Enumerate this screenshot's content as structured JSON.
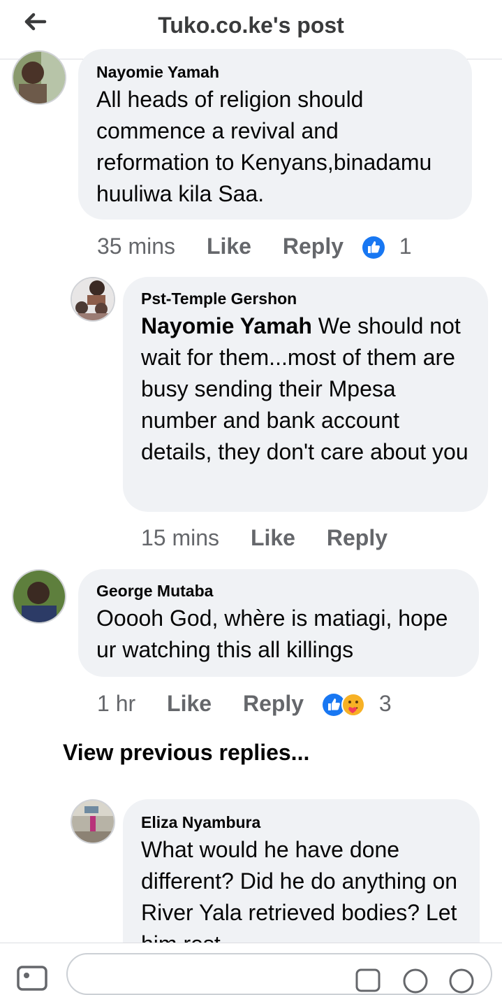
{
  "header": {
    "title": "Tuko.co.ke's post",
    "back_icon": "arrow-left-icon"
  },
  "comments": [
    {
      "author": "Nayomie Yamah",
      "text": "All heads of religion should commence a revival and reformation to Kenyans,binadamu huuliwa kila Saa.",
      "time": "35 mins",
      "like": "Like",
      "reply": "Reply",
      "reaction_count": "1"
    },
    {
      "author": "Pst-Temple Gershon",
      "mention": "Nayomie Yamah",
      "text": " We should not wait for them...most of them are busy sending their Mpesa number and bank account details, they don't care about you",
      "time": "15 mins",
      "like": "Like",
      "reply": "Reply"
    },
    {
      "author": "George Mutaba",
      "text": "Ooooh God, whère is matiagi, hope ur watching this all killings",
      "time": "1 hr",
      "like": "Like",
      "reply": "Reply",
      "reaction_count": "3"
    },
    {
      "author": "Eliza Nyambura",
      "text": "What would he have done different? Did he do anything on River Yala retrieved bodies? Let him rest"
    }
  ],
  "view_previous": "View previous replies...",
  "colors": {
    "bubble": "#f0f2f5",
    "like_blue": "#1877f2",
    "meta_gray": "#65676b"
  }
}
